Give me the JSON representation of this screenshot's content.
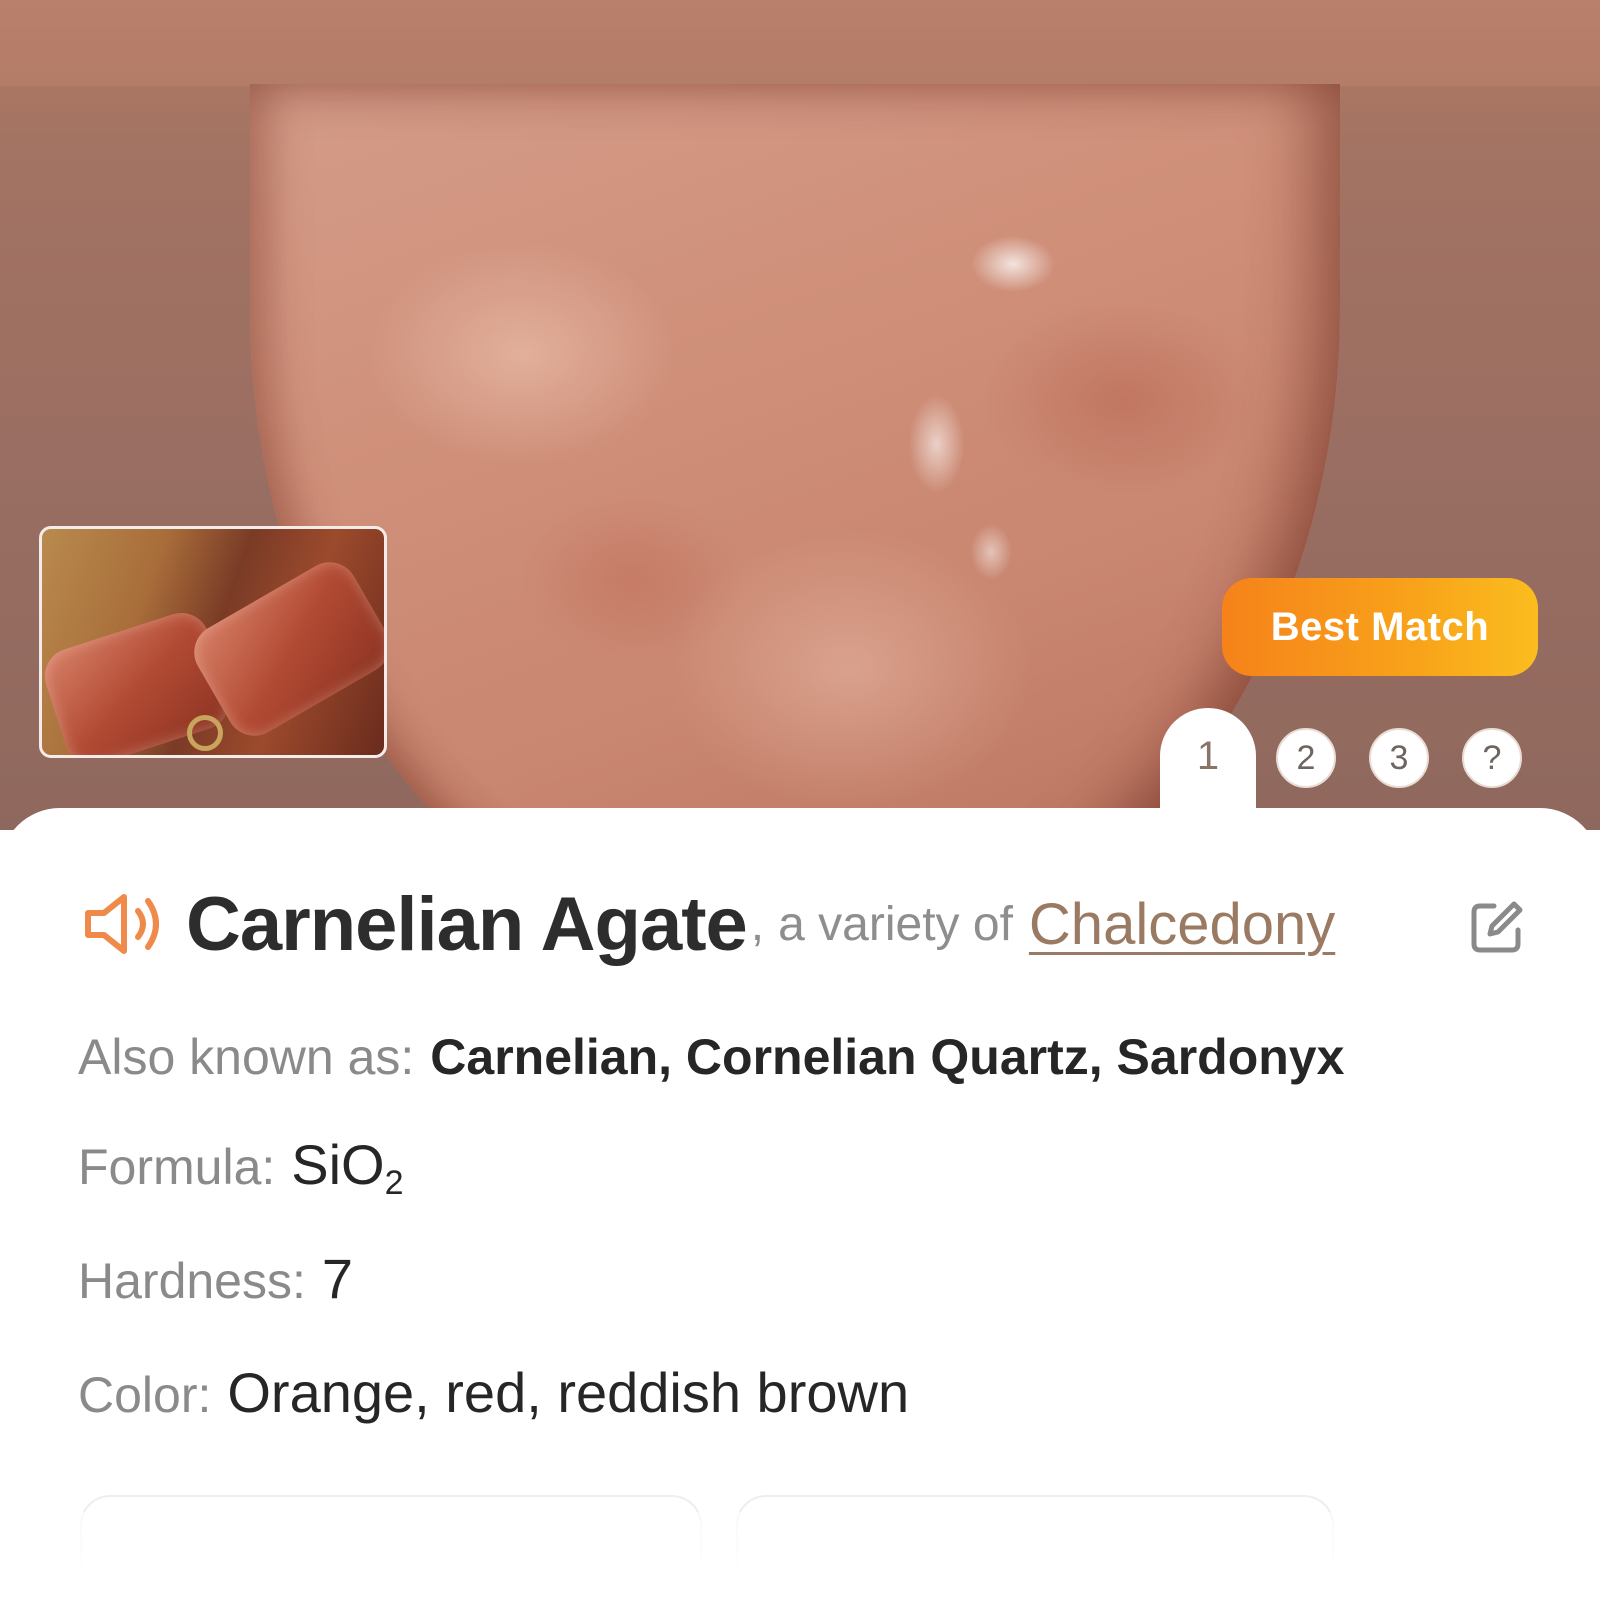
{
  "hero": {
    "badge_label": "Best Match",
    "result_tabs": [
      {
        "label": "1",
        "active": true
      },
      {
        "label": "2",
        "active": false
      },
      {
        "label": "3",
        "active": false
      },
      {
        "label": "?",
        "active": false
      }
    ]
  },
  "title": {
    "name": "Carnelian Agate",
    "separator": ",",
    "variety_text": "a variety of",
    "variety_link": "Chalcedony",
    "speaker_icon": "speaker-icon",
    "edit_icon": "edit-icon"
  },
  "properties": {
    "aka_label": "Also known as:",
    "aka_value": "Carnelian, Cornelian Quartz, Sardonyx",
    "formula_label": "Formula:",
    "formula_main": "SiO",
    "formula_subscript": "2",
    "hardness_label": "Hardness:",
    "hardness_value": "7",
    "color_label": "Color:",
    "color_value": "Orange, red, reddish brown"
  },
  "colors": {
    "accent_orange": "#f6821a",
    "link_brown": "#9a7a63",
    "speaker_orange": "#f08a4b"
  }
}
